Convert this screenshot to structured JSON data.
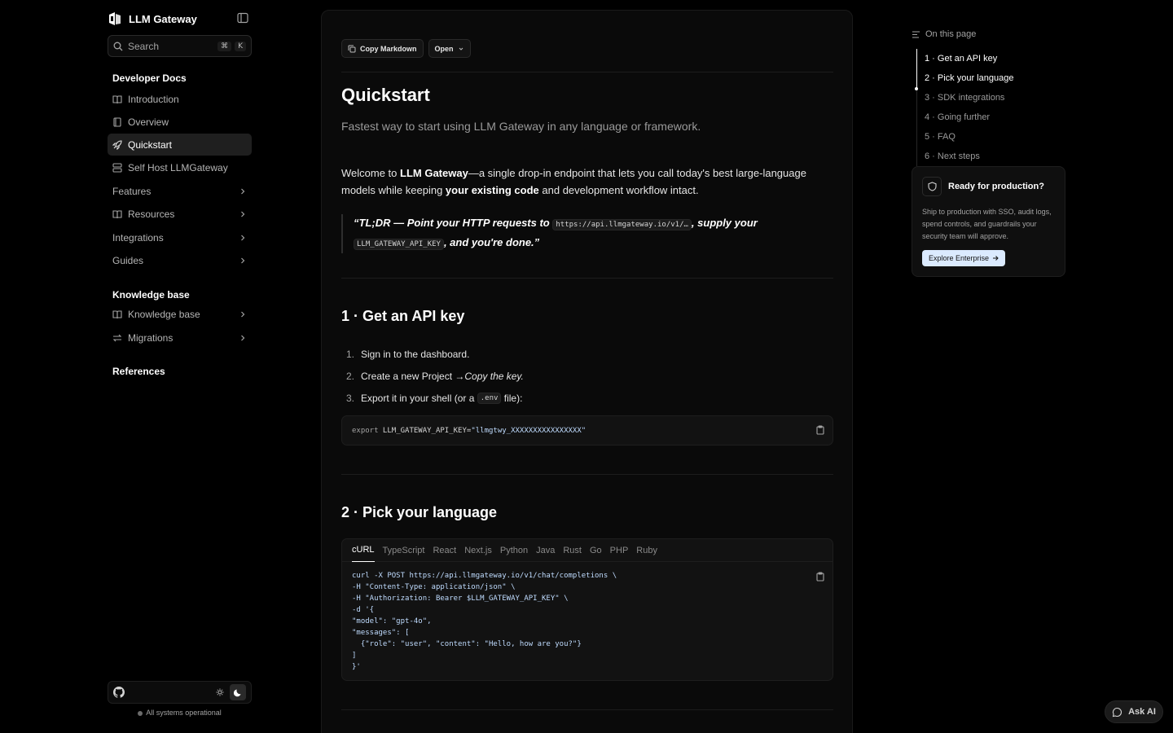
{
  "brand": {
    "name": "LLM Gateway"
  },
  "search": {
    "placeholder": "Search",
    "kbd1": "⌘",
    "kbd2": "K"
  },
  "sidebar": {
    "section1": "Developer Docs",
    "items": [
      {
        "label": "Introduction",
        "icon": "book-icon"
      },
      {
        "label": "Overview",
        "icon": "document-icon"
      },
      {
        "label": "Quickstart",
        "icon": "rocket-icon",
        "active": true
      },
      {
        "label": "Self Host LLMGateway",
        "icon": "server-icon"
      },
      {
        "label": "Features"
      },
      {
        "label": "Resources",
        "icon": "book-icon"
      },
      {
        "label": "Integrations"
      },
      {
        "label": "Guides"
      }
    ],
    "section2": "Knowledge base",
    "kb_items": [
      {
        "label": "Knowledge base",
        "icon": "book-icon"
      },
      {
        "label": "Migrations",
        "icon": "arrows-icon"
      }
    ],
    "section3": "References",
    "status": "All systems operational"
  },
  "toolbar": {
    "copy_label": "Copy Markdown",
    "open_label": "Open"
  },
  "page": {
    "title": "Quickstart",
    "subtitle": "Fastest way to start using LLM Gateway in any language or framework.",
    "intro_a": "Welcome to ",
    "intro_b": "LLM Gateway",
    "intro_c": "—a single drop-in endpoint that lets you call today's best large-language models while keeping ",
    "intro_d": "your existing code",
    "intro_e": " and development workflow intact.",
    "quote_a": "“TL;DR — Point your HTTP requests to ",
    "quote_code1": "https://api.llmgateway.io/v1/…",
    "quote_b": ", supply your ",
    "quote_code2": "LLM_GATEWAY_API_KEY",
    "quote_c": ", and you're done.”",
    "h_api": "1 · Get an API key",
    "steps": [
      {
        "num": "1.",
        "text": "Sign in to the dashboard."
      },
      {
        "num": "2.",
        "text_a": "Create a new Project → ",
        "text_b": "Copy the key."
      },
      {
        "num": "3.",
        "text_a": "Export it in your shell (or a ",
        "code": ".env",
        "text_b": " file):"
      }
    ],
    "export_code": {
      "kw": "export",
      "name": " LLM_GATEWAY_API_KEY=",
      "val": "\"llmgtwy_XXXXXXXXXXXXXXXX\""
    },
    "h_lang": "2 · Pick your language",
    "lang_tabs": [
      "cURL",
      "TypeScript",
      "React",
      "Next.js",
      "Python",
      "Java",
      "Rust",
      "Go",
      "PHP",
      "Ruby"
    ],
    "curl_lines": [
      "curl -X POST https://api.llmgateway.io/v1/chat/completions \\",
      "-H \"Content-Type: application/json\" \\",
      "-H \"Authorization: Bearer $LLM_GATEWAY_API_KEY\" \\",
      "-d '{",
      "\"model\": \"gpt-4o\",",
      "\"messages\": [",
      "  {\"role\": \"user\", \"content\": \"Hello, how are you?\"}",
      "]",
      "}'"
    ]
  },
  "toc": {
    "heading": "On this page",
    "items": [
      "1 · Get an API key",
      "2 · Pick your language",
      "3 · SDK integrations",
      "4 · Going further",
      "5 · FAQ",
      "6 · Next steps"
    ]
  },
  "enterprise": {
    "title": "Ready for production?",
    "desc": "Ship to production with SSO, audit logs, spend controls, and guardrails your security team will approve.",
    "cta": "Explore Enterprise"
  },
  "ask_ai": "Ask AI",
  "colors": {
    "bg": "#000000",
    "panel": "#0a0a0a",
    "accent": "#dbeafe",
    "code_string": "#bfdbfe"
  }
}
